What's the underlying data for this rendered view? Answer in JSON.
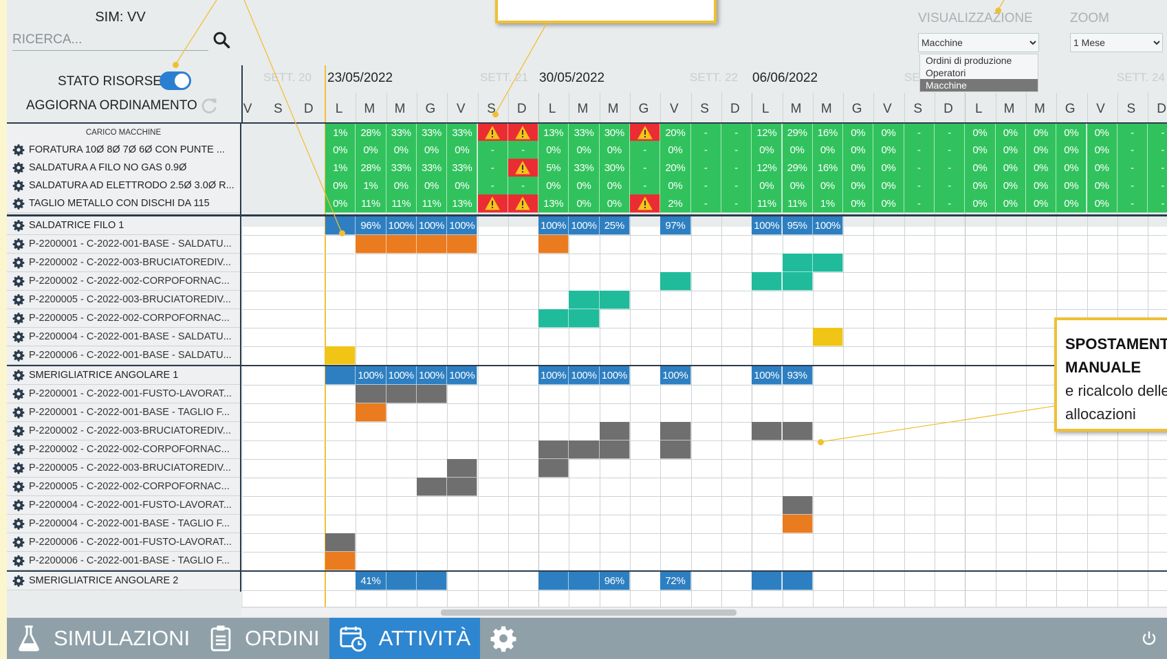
{
  "header": {
    "sim_title": "SIM: VV",
    "search_placeholder": "RICERCA...",
    "stato_risorse_label": "STATO RISORSE",
    "aggiorna_label": "AGGIORNA ORDINAMENTO",
    "stato_risorse_on": true
  },
  "visualizzazione": {
    "label": "VISUALIZZAZIONE",
    "selected": "Macchine",
    "options": [
      "Ordini di produzione",
      "Operatori",
      "Macchine"
    ]
  },
  "zoom": {
    "label": "ZOOM",
    "selected": "1 Mese"
  },
  "weeks": [
    {
      "label": "SETT. 20",
      "faint": true
    },
    {
      "label": "23/05/2022",
      "faint": false
    },
    {
      "label": "SETT. 21",
      "faint": true
    },
    {
      "label": "30/05/2022",
      "faint": false
    },
    {
      "label": "SETT. 22",
      "faint": true
    },
    {
      "label": "06/06/2022",
      "faint": false
    },
    {
      "label": "SE",
      "faint": true
    },
    {
      "label": "SETT. 24",
      "faint": true
    }
  ],
  "days": [
    "V",
    "S",
    "D",
    "L",
    "M",
    "M",
    "G",
    "V",
    "S",
    "D",
    "L",
    "M",
    "M",
    "G",
    "V",
    "S",
    "D",
    "L",
    "M",
    "M",
    "G",
    "V",
    "S",
    "D",
    "L",
    "M",
    "M",
    "G",
    "V",
    "S",
    "D"
  ],
  "carico_label": "CARICO MACCHINE",
  "machine_rows": [
    {
      "label": "FORATURA 10Ø 8Ø 7Ø 6Ø CON PUNTE ...",
      "cells": [
        "0%",
        "0%",
        "0%",
        "0%",
        "0%",
        "-",
        "-",
        "0%",
        "0%",
        "0%",
        "-",
        "0%",
        "-",
        "-",
        "0%",
        "0%",
        "0%",
        "0%",
        "0%",
        "-",
        "-",
        "0%",
        "0%",
        "0%",
        "0%",
        "0%",
        "-",
        "-"
      ]
    },
    {
      "label": "SALDATURA A FILO NO GAS 0.9Ø",
      "cells": [
        "1%",
        "28%",
        "33%",
        "33%",
        "33%",
        "-",
        "!",
        "5%",
        "33%",
        "30%",
        "-",
        "20%",
        "-",
        "-",
        "12%",
        "29%",
        "16%",
        "0%",
        "0%",
        "-",
        "-",
        "0%",
        "0%",
        "0%",
        "0%",
        "0%",
        "-",
        "-"
      ]
    },
    {
      "label": "SALDATURA AD ELETTRODO 2.5Ø 3.0Ø R...",
      "cells": [
        "0%",
        "1%",
        "0%",
        "0%",
        "0%",
        "-",
        "-",
        "0%",
        "0%",
        "0%",
        "-",
        "0%",
        "-",
        "-",
        "0%",
        "0%",
        "0%",
        "0%",
        "0%",
        "-",
        "-",
        "0%",
        "0%",
        "0%",
        "0%",
        "0%",
        "-",
        "-"
      ]
    },
    {
      "label": "TAGLIO METALLO CON DISCHI DA 115",
      "cells": [
        "0%",
        "11%",
        "11%",
        "11%",
        "13%",
        "!",
        "!",
        "13%",
        "0%",
        "0%",
        "!",
        "2%",
        "-",
        "-",
        "11%",
        "11%",
        "1%",
        "0%",
        "0%",
        "-",
        "-",
        "0%",
        "0%",
        "0%",
        "0%",
        "0%",
        "-",
        "-"
      ]
    }
  ],
  "carico_cells": [
    "1%",
    "28%",
    "33%",
    "33%",
    "33%",
    "!",
    "!",
    "13%",
    "33%",
    "30%",
    "!",
    "20%",
    "-",
    "-",
    "12%",
    "29%",
    "16%",
    "0%",
    "0%",
    "-",
    "-",
    "0%",
    "0%",
    "0%",
    "0%",
    "0%",
    "-",
    "-"
  ],
  "resources": [
    {
      "name": "SALDATRICE FILO 1",
      "load": {
        "0": "",
        "1": "96%",
        "2": "100%",
        "3": "100%",
        "4": "100%",
        "7": "100%",
        "8": "100%",
        "9": "25%",
        "11": "97%",
        "14": "100%",
        "15": "95%",
        "16": "100%"
      },
      "tasks": [
        {
          "label": "P-2200001 - C-2022-001-BASE - SALDATU...",
          "blocks": {
            "1": "orange",
            "2": "orange",
            "3": "orange",
            "4": "orange",
            "7": "orange"
          }
        },
        {
          "label": "P-2200002 - C-2022-003-BRUCIATOREDIV...",
          "blocks": {
            "15": "teal",
            "16": "teal"
          }
        },
        {
          "label": "P-2200002 - C-2022-002-CORPOFORNAC...",
          "blocks": {
            "11": "teal",
            "14": "teal",
            "15": "teal"
          }
        },
        {
          "label": "P-2200005 - C-2022-003-BRUCIATOREDIV...",
          "blocks": {
            "8": "teal",
            "9": "teal"
          }
        },
        {
          "label": "P-2200005 - C-2022-002-CORPOFORNAC...",
          "blocks": {
            "7": "teal",
            "8": "teal"
          }
        },
        {
          "label": "P-2200004 - C-2022-001-BASE - SALDATU...",
          "blocks": {
            "16": "yellow"
          }
        },
        {
          "label": "P-2200006 - C-2022-001-BASE - SALDATU...",
          "blocks": {
            "0": "yellow"
          }
        }
      ]
    },
    {
      "name": "SMERIGLIATRICE ANGOLARE 1",
      "load": {
        "0": "",
        "1": "100%",
        "2": "100%",
        "3": "100%",
        "4": "100%",
        "7": "100%",
        "8": "100%",
        "9": "100%",
        "11": "100%",
        "14": "100%",
        "15": "93%"
      },
      "tasks": [
        {
          "label": "P-2200001 - C-2022-001-FUSTO-LAVORAT...",
          "blocks": {
            "1": "gray",
            "2": "gray",
            "3": "gray"
          }
        },
        {
          "label": "P-2200001 - C-2022-001-BASE - TAGLIO F...",
          "blocks": {
            "1": "orange"
          }
        },
        {
          "label": "P-2200002 - C-2022-003-BRUCIATOREDIV...",
          "blocks": {
            "9": "gray",
            "11": "gray",
            "14": "gray",
            "15": "gray"
          }
        },
        {
          "label": "P-2200002 - C-2022-002-CORPOFORNAC...",
          "blocks": {
            "7": "gray",
            "8": "gray",
            "9": "gray",
            "11": "gray"
          }
        },
        {
          "label": "P-2200005 - C-2022-003-BRUCIATOREDIV...",
          "blocks": {
            "4": "gray",
            "7": "gray"
          }
        },
        {
          "label": "P-2200005 - C-2022-002-CORPOFORNAC...",
          "blocks": {
            "3": "gray",
            "4": "gray"
          }
        },
        {
          "label": "P-2200004 - C-2022-001-FUSTO-LAVORAT...",
          "blocks": {
            "15": "gray"
          }
        },
        {
          "label": "P-2200004 - C-2022-001-BASE - TAGLIO F...",
          "blocks": {
            "15": "orange"
          }
        },
        {
          "label": "P-2200006 - C-2022-001-FUSTO-LAVORAT...",
          "blocks": {
            "0": "gray"
          }
        },
        {
          "label": "P-2200006 - C-2022-001-BASE - TAGLIO F...",
          "blocks": {
            "0": "orange"
          }
        }
      ]
    },
    {
      "name": "SMERIGLIATRICE ANGOLARE 2",
      "load": {
        "1": "41%",
        "2": "",
        "3": "",
        "7": "",
        "8": "",
        "9": "96%",
        "11": "72%",
        "14": "",
        "15": ""
      },
      "tasks": []
    }
  ],
  "callout": {
    "title_line1": "SPOSTAMENTI",
    "title_line2": "MANUALE",
    "text_line1": "e ricalcolo delle",
    "text_line2": "allocazioni"
  },
  "nav": {
    "simulazioni": "SIMULAZIONI",
    "ordini": "ORDINI",
    "attivita": "ATTIVITÀ"
  },
  "colors": {
    "green": "#31c25d",
    "red": "#ea2d32",
    "blue": "#2e7fc1",
    "orange": "#ea7b1e",
    "teal": "#1fbb9b",
    "gray": "#6f6f6f",
    "yellow": "#f0c516",
    "accent": "#2e86d0"
  }
}
